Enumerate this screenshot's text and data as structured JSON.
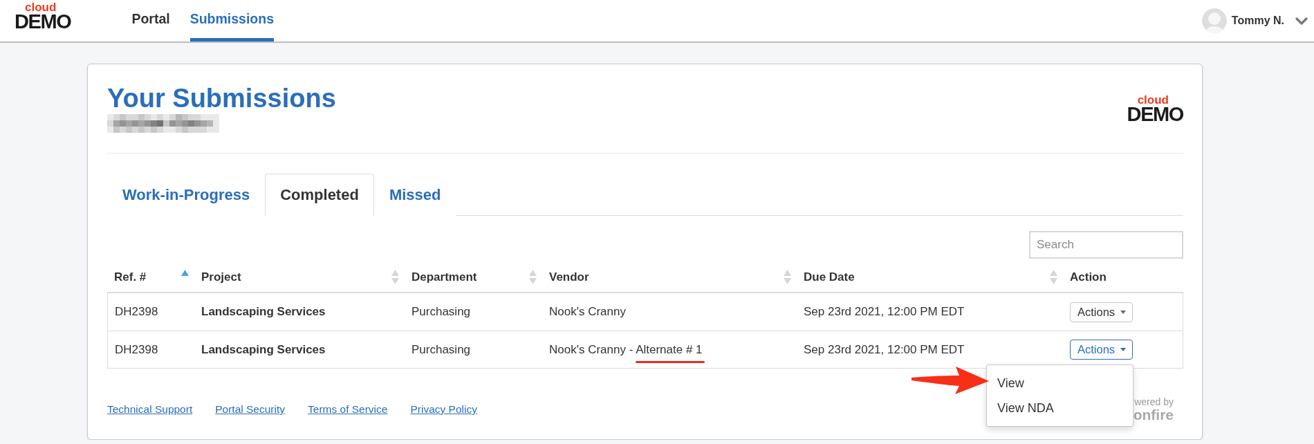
{
  "nav": {
    "logo": {
      "top": "cloud",
      "main": "DEMO"
    },
    "links": [
      {
        "label": "Portal",
        "selected": false
      },
      {
        "label": "Submissions",
        "selected": true
      }
    ],
    "user": {
      "name": "Tommy N."
    }
  },
  "card": {
    "title": "Your Submissions",
    "subtitle": {
      "redacted": true
    },
    "logo": {
      "top": "cloud",
      "main": "DEMO"
    },
    "tabs": [
      {
        "label": "Work-in-Progress",
        "selected": false
      },
      {
        "label": "Completed",
        "selected": true
      },
      {
        "label": "Missed",
        "selected": false
      }
    ],
    "search": {
      "placeholder": "Search"
    },
    "table": {
      "columns": [
        {
          "label": "Ref. #",
          "sortable": true,
          "sorted": true
        },
        {
          "label": "Project",
          "sortable": true,
          "sorted": false
        },
        {
          "label": "Department",
          "sortable": true,
          "sorted": false
        },
        {
          "label": "Vendor",
          "sortable": true,
          "sorted": false
        },
        {
          "label": "Due Date",
          "sortable": true,
          "sorted": false
        },
        {
          "label": "Action",
          "sortable": false
        }
      ],
      "rows": [
        {
          "ref": "DH2398",
          "project": "Landscaping Services",
          "department": "Purchasing",
          "vendor": "Nook's Cranny",
          "vendor_underlined": false,
          "due_date": "Sep 23rd 2021, 12:00 PM EDT",
          "action": {
            "label": "Actions",
            "open": false
          }
        },
        {
          "ref": "DH2398",
          "project": "Landscaping Services",
          "department": "Purchasing",
          "vendor": "Nook's Cranny - Alternate # 1",
          "vendor_underlined": true,
          "due_date": "Sep 23rd 2021, 12:00 PM EDT",
          "action": {
            "label": "Actions",
            "open": true,
            "menu": {
              "items": [
                {
                  "label": "View"
                },
                {
                  "label": "View NDA"
                }
              ],
              "pointer_arrow": true
            }
          }
        }
      ]
    },
    "footer": {
      "links": [
        "Technical Support",
        "Portal Security",
        "Terms of Service",
        "Privacy Policy"
      ],
      "powered_by": {
        "caption": "wered by",
        "brand": "onfire"
      }
    }
  }
}
